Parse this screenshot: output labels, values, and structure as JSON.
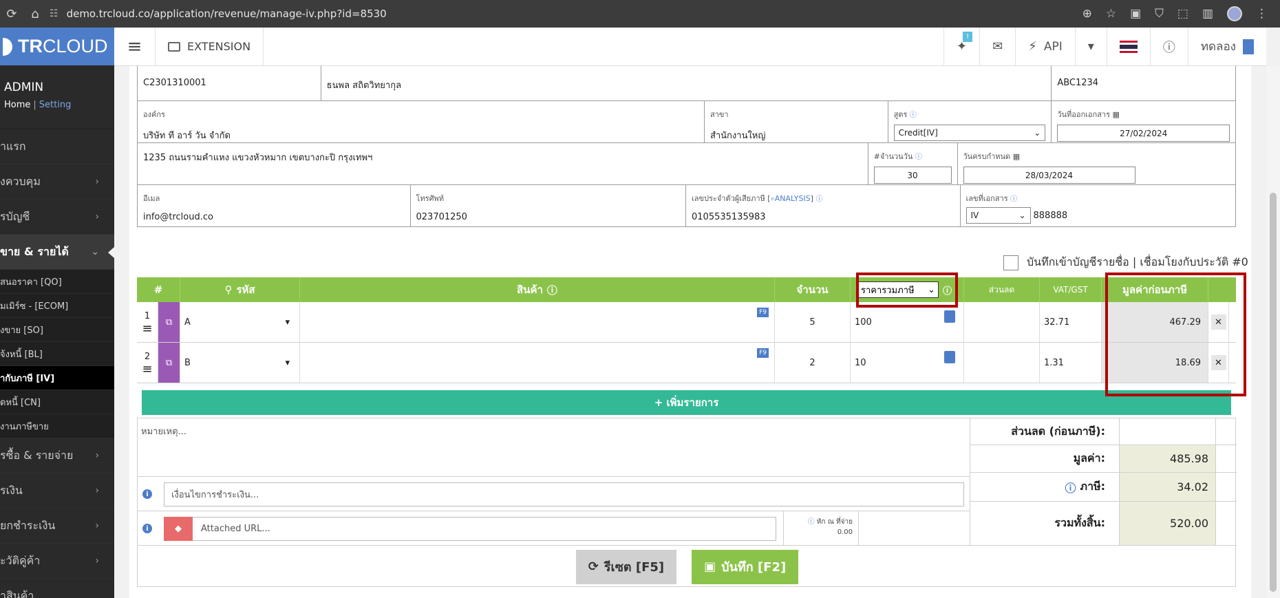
{
  "browser": {
    "url": "demo.trcloud.co/application/revenue/manage-iv.php?id=8530"
  },
  "sidebar": {
    "logo_bold": "TR",
    "logo_rest": "CLOUD",
    "user": "ADMIN",
    "home": "Home",
    "setting": "Setting",
    "items": [
      {
        "label": "าแรก"
      },
      {
        "label": "งควบคุม"
      },
      {
        "label": "รบัญชี"
      },
      {
        "label": "ขาย & รายได้"
      },
      {
        "label": "รซื้อ & รายจ่าย"
      },
      {
        "label": "รเงิน"
      },
      {
        "label": "ยกชำระเงิน"
      },
      {
        "label": "ะวัติคู่ค้า"
      },
      {
        "label": "าสินค้า"
      }
    ],
    "subitems": [
      {
        "label": "สนอราคา [QO]"
      },
      {
        "label": "มเมิร์ซ - [ECOM]"
      },
      {
        "label": "งขาย [SO]"
      },
      {
        "label": "จ้งหนี้ [BL]"
      },
      {
        "label": "ากับภาษี [IV]"
      },
      {
        "label": "ดหนี้ [CN]"
      },
      {
        "label": "งานภาษีขาย"
      }
    ]
  },
  "topnav": {
    "extension": "EXTENSION",
    "badge": "!",
    "api": "API",
    "trial": "ทดลอง"
  },
  "form": {
    "row0": {
      "customer_code": "C2301310001",
      "contact": "ธนพล สถิตวิทยากุล",
      "ref": "ABC1234"
    },
    "row1": {
      "org_label": "องค์กร",
      "org": "บริษัท ที อาร์ วัน จำกัด",
      "branch_label": "สาขา",
      "branch": "สำนักงานใหญ่",
      "formula_label": "สูตร",
      "formula": "Credit[IV]",
      "date_label": "วันที่ออกเอกสาร",
      "date": "27/02/2024"
    },
    "row2": {
      "address": "1235 ถนนรามคำแหง แขวงหัวหมาก เขตบางกะปิ กรุงเทพฯ",
      "days_label": "#จำนวนวัน",
      "days": "30",
      "due_label": "วันครบกำหนด",
      "due": "28/03/2024"
    },
    "row3": {
      "email_label": "อีเมล",
      "email": "info@trcloud.co",
      "phone_label": "โทรศัพท์",
      "phone": "023701250",
      "tax_label": "เลขประจำตัวผู้เสียภาษี",
      "analysis": "ANALYSIS",
      "tax": "0105535135983",
      "doc_label": "เลขที่เอกสาร",
      "doc_prefix": "IV",
      "doc_no": "888888"
    },
    "ledger_text": "บันทึกเข้าบัญชีรายชื่อ | เชื่อมโยงกับประวัติ #0"
  },
  "items": {
    "headers": {
      "no": "#",
      "code": "รหัส",
      "product": "สินค้า",
      "qty": "จำนวน",
      "price_mode": "ราคารวมภาษี",
      "discount": "ส่วนลด",
      "vat": "VAT/GST",
      "amount": "มูลค่าก่อนภาษี"
    },
    "rows": [
      {
        "no": "1",
        "code": "A",
        "qty": "5",
        "price": "100",
        "vat": "32.71",
        "amount": "467.29"
      },
      {
        "no": "2",
        "code": "B",
        "qty": "2",
        "price": "10",
        "vat": "1.31",
        "amount": "18.69"
      }
    ],
    "add_label": "+ เพิ่มรายการ"
  },
  "footer": {
    "note_placeholder": "หมายเหตุ...",
    "cond_placeholder": "เงื่อนไขการชำระเงิน...",
    "url_placeholder": "Attached URL...",
    "wht_label": "หัก ณ ที่จ่าย",
    "wht_value": "0.00",
    "discount_label": "ส่วนลด (ก่อนภาษี):",
    "subtotal_label": "มูลค่า:",
    "subtotal": "485.98",
    "tax_label": "ภาษี:",
    "tax": "34.02",
    "total_label": "รวมทั้งสิ้น:",
    "total": "520.00",
    "reset": "รีเซต [F5]",
    "save": "บันทึก [F2]"
  }
}
